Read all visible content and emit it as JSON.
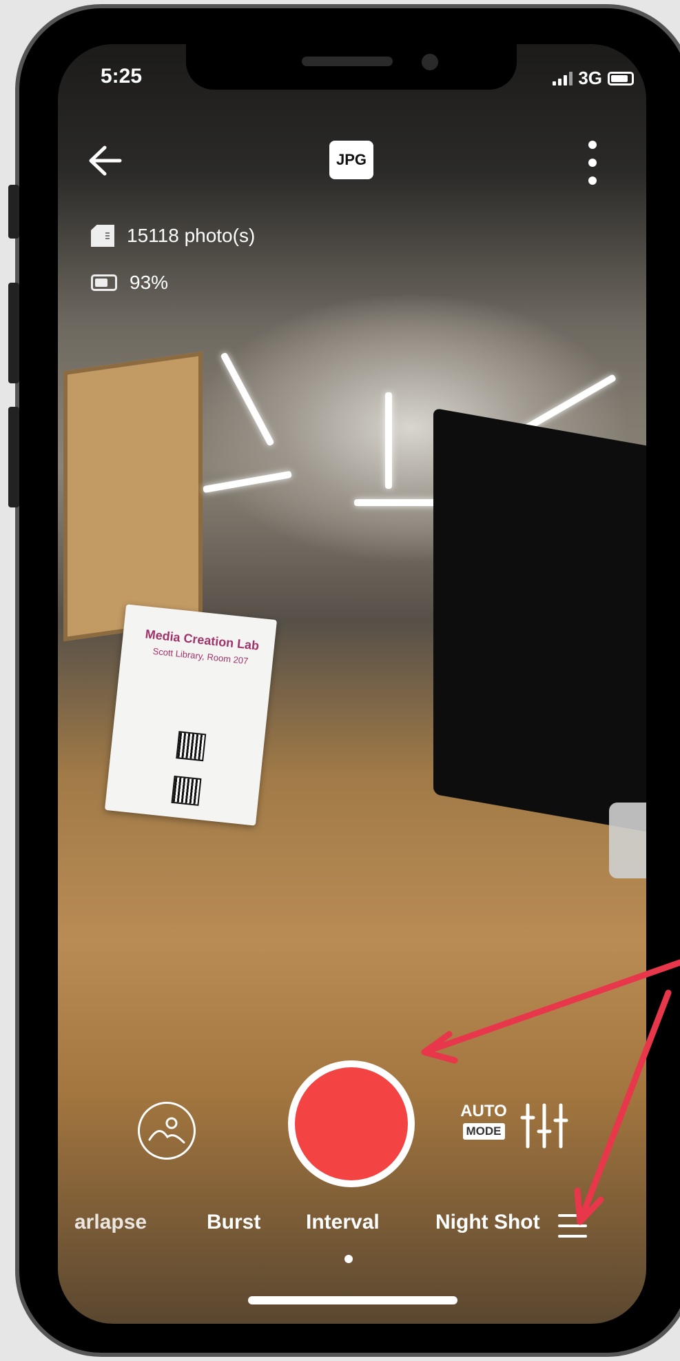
{
  "status_bar": {
    "time": "5:25",
    "network": "3G"
  },
  "top_bar": {
    "back_icon": "arrow-left-icon",
    "format": "JPG",
    "more_icon": "vertical-dots-icon"
  },
  "info": {
    "photos_remaining": "15118 photo(s)",
    "battery": "93%"
  },
  "scene_text": {
    "sign_title": "Media Creation Lab",
    "sign_subtitle": "Scott Library, Room 207"
  },
  "controls": {
    "gallery_icon": "gallery-icon",
    "shutter_color": "#f34443",
    "auto_label": "AUTO",
    "mode_label": "MODE",
    "settings_icon": "sliders-icon"
  },
  "mode_tabs": [
    {
      "label": "arlapse",
      "active": false
    },
    {
      "label": "Burst",
      "active": false
    },
    {
      "label": "Interval",
      "active": true
    },
    {
      "label": "Night Shot",
      "active": false
    }
  ],
  "menu_icon": "hamburger-menu-icon",
  "annotation_color": "#e8374a"
}
